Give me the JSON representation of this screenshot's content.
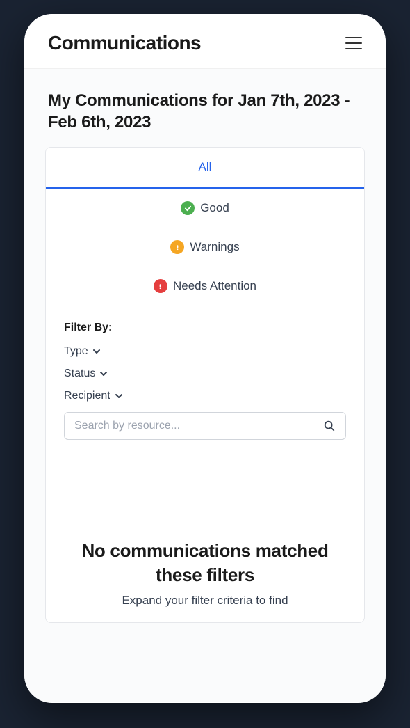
{
  "header": {
    "title": "Communications"
  },
  "page": {
    "title": "My Communications for Jan 7th, 2023 - Feb 6th, 2023"
  },
  "tabs": {
    "all": "All",
    "good": "Good",
    "warnings": "Warnings",
    "needs_attention": "Needs Attention"
  },
  "filters": {
    "title": "Filter By:",
    "type": "Type",
    "status": "Status",
    "recipient": "Recipient"
  },
  "search": {
    "placeholder": "Search by resource..."
  },
  "empty": {
    "title": "No communications matched these filters",
    "subtitle": "Expand your filter criteria to find"
  },
  "colors": {
    "accent": "#2563eb",
    "good": "#4caf50",
    "warning": "#f5a623",
    "danger": "#e53e3e"
  }
}
